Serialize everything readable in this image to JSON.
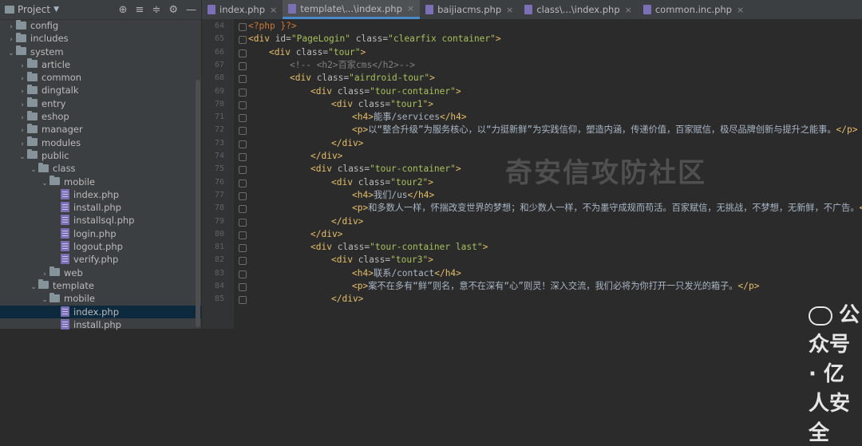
{
  "project": {
    "title": "Project",
    "tree": [
      {
        "depth": 1,
        "kind": "folder",
        "open": false,
        "label": "config"
      },
      {
        "depth": 1,
        "kind": "folder",
        "open": false,
        "label": "includes"
      },
      {
        "depth": 1,
        "kind": "folder",
        "open": true,
        "label": "system"
      },
      {
        "depth": 2,
        "kind": "folder",
        "open": false,
        "label": "article"
      },
      {
        "depth": 2,
        "kind": "folder",
        "open": false,
        "label": "common"
      },
      {
        "depth": 2,
        "kind": "folder",
        "open": false,
        "label": "dingtalk"
      },
      {
        "depth": 2,
        "kind": "folder",
        "open": false,
        "label": "entry"
      },
      {
        "depth": 2,
        "kind": "folder",
        "open": false,
        "label": "eshop"
      },
      {
        "depth": 2,
        "kind": "folder",
        "open": false,
        "label": "manager"
      },
      {
        "depth": 2,
        "kind": "folder",
        "open": false,
        "label": "modules"
      },
      {
        "depth": 2,
        "kind": "folder",
        "open": true,
        "label": "public"
      },
      {
        "depth": 3,
        "kind": "folder",
        "open": true,
        "label": "class"
      },
      {
        "depth": 4,
        "kind": "folder",
        "open": true,
        "label": "mobile"
      },
      {
        "depth": 5,
        "kind": "file",
        "label": "index.php"
      },
      {
        "depth": 5,
        "kind": "file",
        "label": "install.php"
      },
      {
        "depth": 5,
        "kind": "file",
        "label": "installsql.php"
      },
      {
        "depth": 5,
        "kind": "file",
        "label": "login.php"
      },
      {
        "depth": 5,
        "kind": "file",
        "label": "logout.php"
      },
      {
        "depth": 5,
        "kind": "file",
        "label": "verify.php"
      },
      {
        "depth": 4,
        "kind": "folder",
        "open": false,
        "label": "web"
      },
      {
        "depth": 3,
        "kind": "folder",
        "open": true,
        "label": "template"
      },
      {
        "depth": 4,
        "kind": "folder",
        "open": true,
        "label": "mobile"
      },
      {
        "depth": 5,
        "kind": "file",
        "label": "index.php",
        "selected": true
      },
      {
        "depth": 5,
        "kind": "file",
        "label": "install.php"
      }
    ]
  },
  "tabs": [
    {
      "label": "index.php",
      "active": false
    },
    {
      "label": "template\\...\\index.php",
      "active": true
    },
    {
      "label": "baijiacms.php",
      "active": false
    },
    {
      "label": "class\\...\\index.php",
      "active": false
    },
    {
      "label": "common.inc.php",
      "active": false
    }
  ],
  "code": [
    {
      "n": "64",
      "indent": 0,
      "html": "<span class='php'>&lt;?php }?&gt;</span>"
    },
    {
      "n": "65",
      "indent": 0,
      "html": "<span class='tag'>&lt;div </span><span class='attr'>id=</span><span class='val'>\"PageLogin\"</span><span class='attr'> class=</span><span class='val'>\"clearfix container\"</span><span class='tag'>&gt;</span>"
    },
    {
      "n": "66",
      "indent": 1,
      "html": "<span class='tag'>&lt;div </span><span class='attr'>class=</span><span class='val'>\"tour\"</span><span class='tag'>&gt;</span>"
    },
    {
      "n": "67",
      "indent": 2,
      "html": "<span class='cmt'>&lt;!-- &lt;h2&gt;百家cms&lt;/h2&gt;--&gt;</span>"
    },
    {
      "n": "68",
      "indent": 2,
      "html": "<span class='tag'>&lt;div </span><span class='attr'>class=</span><span class='val'>\"airdroid-tour\"</span><span class='tag'>&gt;</span>"
    },
    {
      "n": "69",
      "indent": 3,
      "html": "<span class='tag'>&lt;div </span><span class='attr'>class=</span><span class='val'>\"tour-container\"</span><span class='tag'>&gt;</span>"
    },
    {
      "n": "70",
      "indent": 4,
      "html": "<span class='tag'>&lt;div </span><span class='attr'>class=</span><span class='val'>\"tour1\"</span><span class='tag'>&gt;</span>"
    },
    {
      "n": "71",
      "indent": 5,
      "html": "<span class='tag'>&lt;h4&gt;</span><span class='txt'>能事/services</span><span class='tag'>&lt;/h4&gt;</span>"
    },
    {
      "n": "72",
      "indent": 5,
      "html": "<span class='tag'>&lt;p&gt;</span><span class='txt'>以“整合升级”为服务核心，以“力挺新鲜”为实践信仰，塑造内涵，传递价值，百家赋信，极尽品牌创新与提升之能事。</span><span class='tag'>&lt;/p&gt;</span>"
    },
    {
      "n": "73",
      "indent": 4,
      "html": "<span class='tag'>&lt;/div&gt;</span>"
    },
    {
      "n": "74",
      "indent": 3,
      "html": "<span class='tag'>&lt;/div&gt;</span>"
    },
    {
      "n": "75",
      "indent": 3,
      "html": "<span class='tag'>&lt;div </span><span class='attr'>class=</span><span class='val'>\"tour-container\"</span><span class='tag'>&gt;</span>"
    },
    {
      "n": "76",
      "indent": 4,
      "html": "<span class='tag'>&lt;div </span><span class='attr'>class=</span><span class='val'>\"tour2\"</span><span class='tag'>&gt;</span>"
    },
    {
      "n": "77",
      "indent": 5,
      "html": "<span class='tag'>&lt;h4&gt;</span><span class='txt'>我们/us</span><span class='tag'>&lt;/h4&gt;</span>"
    },
    {
      "n": "78",
      "indent": 5,
      "html": "<span class='tag'>&lt;p&gt;</span><span class='txt'>和多数人一样，怀揣改变世界的梦想；和少数人一样，不为墨守成规而苟活。百家赋信，无挑战，不梦想，无新鲜，不广告。</span><span class='tag'>&lt;/p&gt;</span>"
    },
    {
      "n": "79",
      "indent": 4,
      "html": "<span class='tag'>&lt;/div&gt;</span>"
    },
    {
      "n": "80",
      "indent": 3,
      "html": "<span class='tag'>&lt;/div&gt;</span>"
    },
    {
      "n": "81",
      "indent": 3,
      "html": "<span class='tag'>&lt;div </span><span class='attr'>class=</span><span class='val'>\"tour-container last\"</span><span class='tag'>&gt;</span>"
    },
    {
      "n": "82",
      "indent": 4,
      "html": "<span class='tag'>&lt;div </span><span class='attr'>class=</span><span class='val'>\"tour3\"</span><span class='tag'>&gt;</span>"
    },
    {
      "n": "83",
      "indent": 5,
      "html": "<span class='tag'>&lt;h4&gt;</span><span class='txt'>联系/contact</span><span class='tag'>&lt;/h4&gt;</span>"
    },
    {
      "n": "84",
      "indent": 5,
      "html": "<span class='tag'>&lt;p&gt;</span><span class='txt'>案不在多有“鲜”则名，意不在深有“心”则灵！深入交流，我们必将为你打开一只发光的箱子。</span><span class='tag'>&lt;/p&gt;</span>"
    },
    {
      "n": "85",
      "indent": 4,
      "html": "<span class='tag'>&lt;/div&gt;</span>"
    }
  ],
  "watermark": "奇安信攻防社区",
  "watermark2": "公众号 · 亿人安全"
}
